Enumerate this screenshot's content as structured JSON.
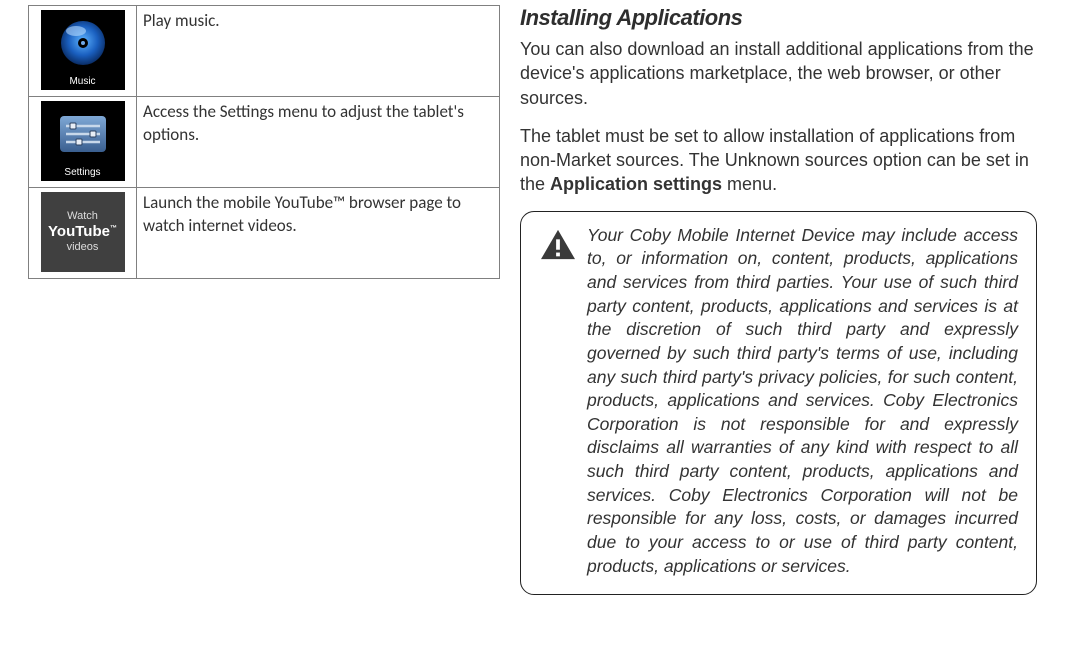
{
  "icons": {
    "music": {
      "label": "Music",
      "desc": "Play music."
    },
    "settings": {
      "label": "Settings",
      "desc": "Access the Settings menu to adjust the tablet's options."
    },
    "youtube": {
      "line1": "Watch",
      "line2": "YouTube",
      "line3": "videos",
      "desc": "Launch the mobile YouTube™ browser page to watch internet videos."
    }
  },
  "section": {
    "title": "Installing Applications",
    "para1": "You can also download an install additional applications from the device's applications marketplace, the web browser, or other sources.",
    "para2_pre": "The tablet must be set to allow installation of applications from non-Market sources. The Unknown sources option can be set in the ",
    "para2_bold": "Application settings",
    "para2_post": " menu."
  },
  "notice": "Your Coby Mobile Internet Device may include access to, or information on, content, products, applications and services from third parties. Your use of such third party content, products, applications and services is at the discretion of such third party and expressly governed by such third party's terms of use, including any such third party's privacy policies, for such content, products, applications and services. Coby Electronics Corporation is not responsible for and expressly disclaims all warranties of any kind with respect to all such third party content, products, applications and services. Coby Electronics Corporation will not be responsible for any loss, costs, or damages incurred due to your access to or use of third party content, products, applications or services."
}
